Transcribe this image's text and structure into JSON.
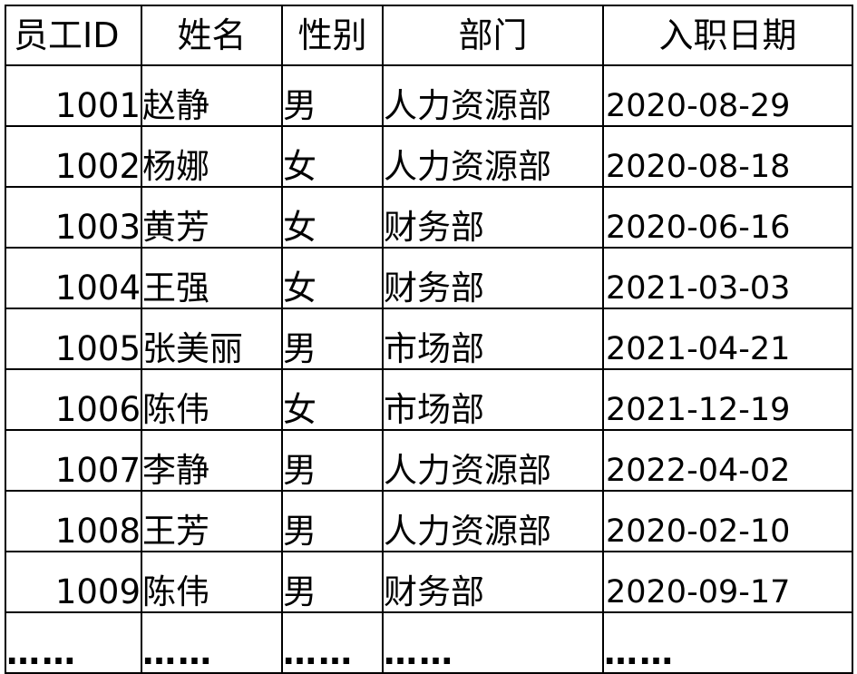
{
  "table": {
    "columns": [
      "员工ID",
      "姓名",
      "性别",
      "部门",
      "入职日期"
    ],
    "rows": [
      {
        "id": "1001",
        "name": "赵静",
        "gender": "男",
        "dept": "人力资源部",
        "date": "2020-08-29"
      },
      {
        "id": "1002",
        "name": "杨娜",
        "gender": "女",
        "dept": "人力资源部",
        "date": "2020-08-18"
      },
      {
        "id": "1003",
        "name": "黄芳",
        "gender": "女",
        "dept": "财务部",
        "date": "2020-06-16"
      },
      {
        "id": "1004",
        "name": "王强",
        "gender": "女",
        "dept": "财务部",
        "date": "2021-03-03"
      },
      {
        "id": "1005",
        "name": "张美丽",
        "gender": "男",
        "dept": "市场部",
        "date": "2021-04-21"
      },
      {
        "id": "1006",
        "name": "陈伟",
        "gender": "女",
        "dept": "市场部",
        "date": "2021-12-19"
      },
      {
        "id": "1007",
        "name": "李静",
        "gender": "男",
        "dept": "人力资源部",
        "date": "2022-04-02"
      },
      {
        "id": "1008",
        "name": "王芳",
        "gender": "男",
        "dept": "人力资源部",
        "date": "2020-02-10"
      },
      {
        "id": "1009",
        "name": "陈伟",
        "gender": "男",
        "dept": "财务部",
        "date": "2020-09-17"
      }
    ],
    "ellipsis_row": [
      "……",
      "……",
      "……",
      "……",
      "……"
    ]
  }
}
